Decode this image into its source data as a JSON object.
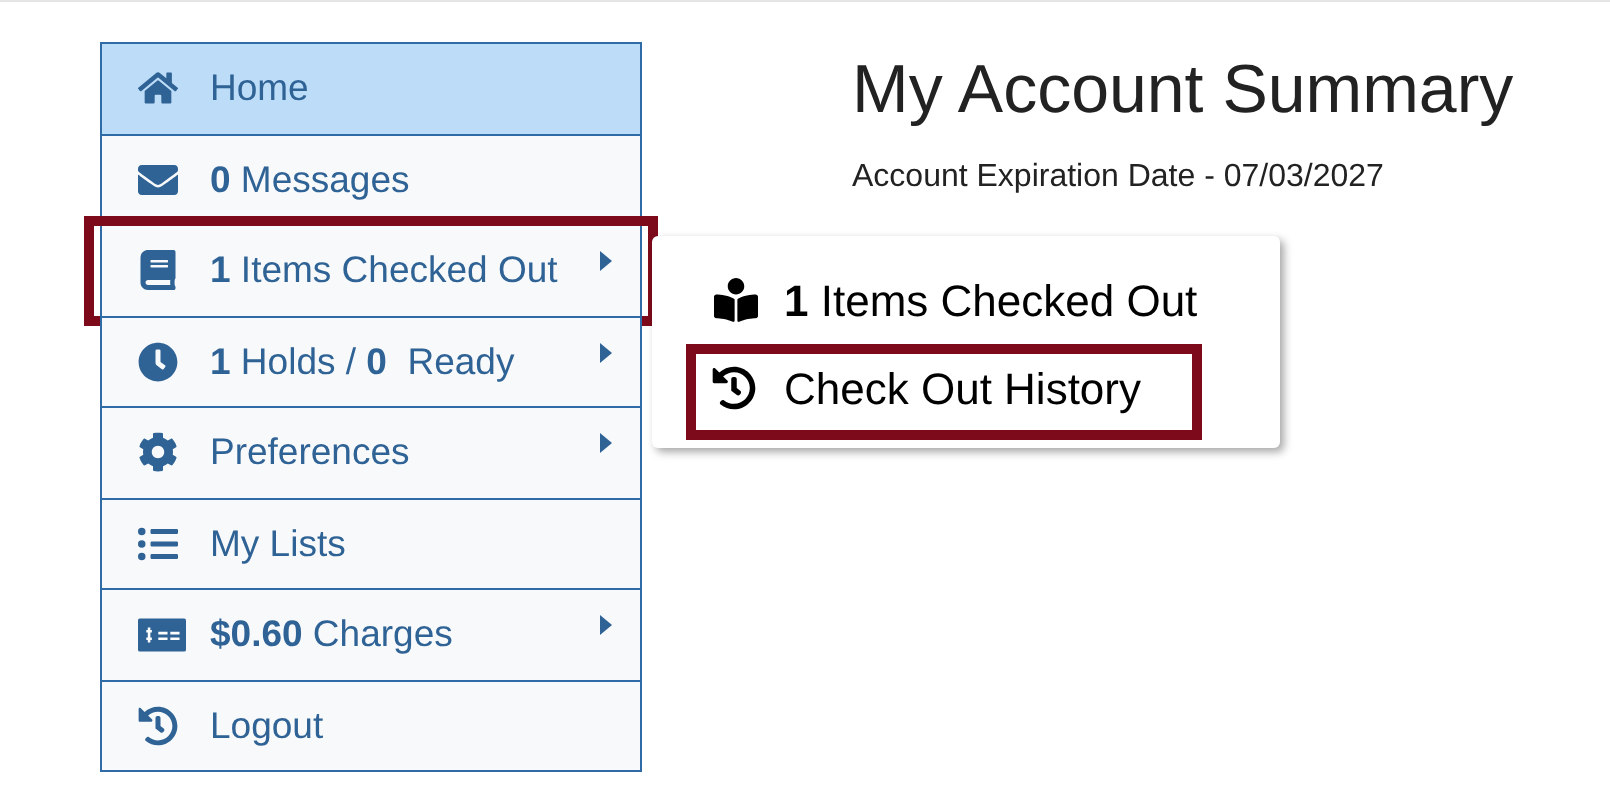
{
  "sidebar": {
    "items": [
      {
        "kind": "home",
        "label": "Home",
        "selected": true,
        "submenu": false,
        "highlighted": false
      },
      {
        "kind": "messages",
        "label": "**0** Messages",
        "selected": false,
        "submenu": false,
        "highlighted": false
      },
      {
        "kind": "checkouts",
        "label": "**1** Items Checked Out",
        "selected": false,
        "submenu": true,
        "highlighted": true
      },
      {
        "kind": "holds",
        "label": "**1** Holds / **0**  Ready",
        "selected": false,
        "submenu": true,
        "highlighted": false
      },
      {
        "kind": "preferences",
        "label": "Preferences",
        "selected": false,
        "submenu": true,
        "highlighted": false
      },
      {
        "kind": "lists",
        "label": "My Lists",
        "selected": false,
        "submenu": false,
        "highlighted": false
      },
      {
        "kind": "charges",
        "label": "**$0.60** Charges",
        "selected": false,
        "submenu": true,
        "highlighted": false
      },
      {
        "kind": "logout",
        "label": "Logout",
        "selected": false,
        "submenu": false,
        "highlighted": false
      }
    ]
  },
  "main": {
    "title": "My Account Summary",
    "expiration": "Account Expiration Date - 07/03/2027"
  },
  "popup_menu": {
    "items": [
      {
        "kind": "checkouts",
        "label": "**1** Items Checked Out",
        "highlighted": false
      },
      {
        "kind": "history",
        "label": "Check Out History",
        "highlighted": true
      }
    ]
  }
}
